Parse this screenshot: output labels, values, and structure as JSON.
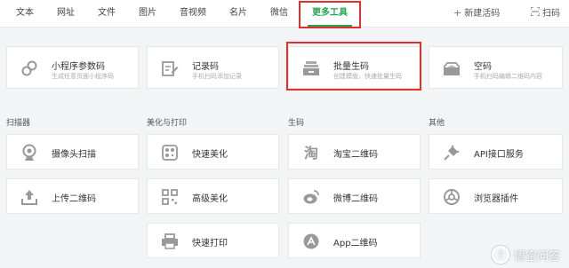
{
  "nav": {
    "tabs": [
      {
        "label": "文本"
      },
      {
        "label": "网址"
      },
      {
        "label": "文件"
      },
      {
        "label": "图片"
      },
      {
        "label": "音视频"
      },
      {
        "label": "名片"
      },
      {
        "label": "微信"
      },
      {
        "label": "更多工具",
        "active": true
      }
    ],
    "new_code_label": "新建活码",
    "scan_label": "扫码"
  },
  "top_cards": [
    {
      "title": "小程序参数码",
      "sub": "生成任意页面小程序码",
      "icon": "link-icon"
    },
    {
      "title": "记录码",
      "sub": "手机扫码添加记录",
      "icon": "edit-doc-icon"
    },
    {
      "title": "批量生码",
      "sub": "创建模版，快速批量生码",
      "icon": "batch-stack-icon"
    },
    {
      "title": "空码",
      "sub": "手机扫码编辑二维码内容",
      "icon": "empty-box-icon"
    }
  ],
  "sections": {
    "scanner": "扫描器",
    "beautify": "美化与打印",
    "generate": "生码",
    "other": "其他"
  },
  "tools": {
    "camera_scan": "摄像头扫描",
    "upload_qr": "上传二维码",
    "quick_beautify": "快速美化",
    "advanced_beautify": "高级美化",
    "quick_print": "快速打印",
    "taobao_qr": "淘宝二维码",
    "weibo_qr": "微博二维码",
    "app_qr": "App二维码",
    "api_service": "API接口服务",
    "browser_plugin": "浏览器插件"
  },
  "watermark": {
    "text": "悟空问答"
  },
  "colors": {
    "accent": "#22a94f",
    "highlight": "#e0302a",
    "icon": "#999999"
  }
}
